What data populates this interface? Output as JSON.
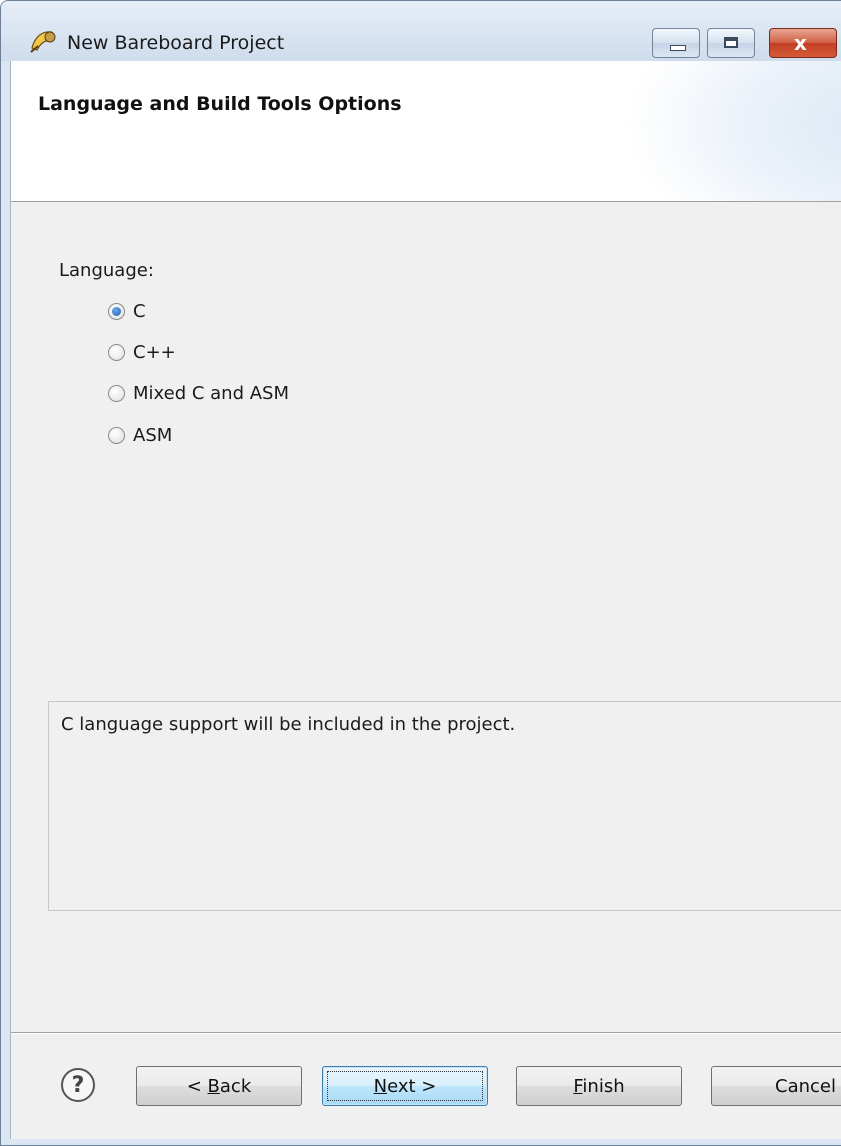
{
  "window": {
    "title": "New Bareboard Project",
    "app_icon": "eclipse-wizard-icon"
  },
  "window_controls": {
    "minimize_icon": "minimize-icon",
    "maximize_icon": "maximize-icon",
    "close_label": "x"
  },
  "banner": {
    "title": "Language and Build Tools Options"
  },
  "language": {
    "label": "Language:",
    "options": [
      {
        "label": "C",
        "checked": true
      },
      {
        "label": "C++",
        "checked": false
      },
      {
        "label": "Mixed C and ASM",
        "checked": false
      },
      {
        "label": "ASM",
        "checked": false
      }
    ]
  },
  "description": {
    "text": "C language support will be included in the project."
  },
  "footer": {
    "help_label": "?",
    "back_prefix": "< ",
    "back_mnemonic": "B",
    "back_rest": "ack",
    "next_mnemonic": "N",
    "next_rest": "ext >",
    "finish_mnemonic": "F",
    "finish_rest": "inish",
    "cancel_label": "Cancel"
  },
  "colors": {
    "accent": "#3c7fb1",
    "radio_selected": "#1d5fb8",
    "close_button": "#c13e22"
  }
}
